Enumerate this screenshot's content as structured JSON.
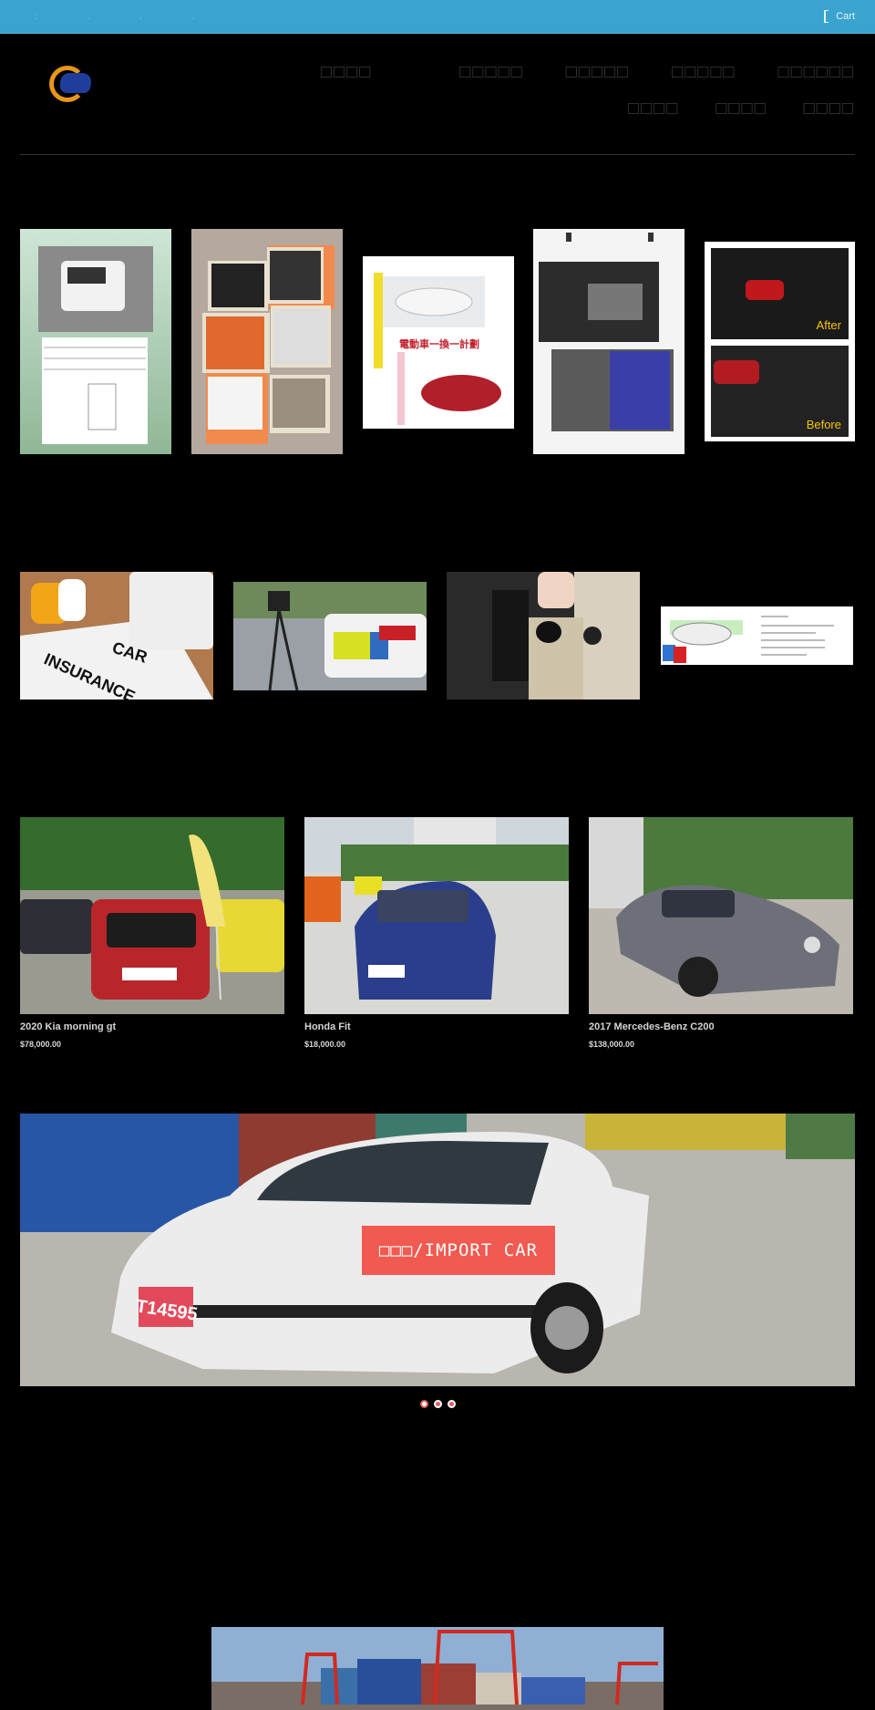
{
  "topbar": {
    "left_glyphs": ":  .   .   .",
    "cart_label": "Cart",
    "bg_color": "#3aa3cf"
  },
  "header": {
    "logo_alt": "logo",
    "nav_row1": [
      "□□□□",
      "□□□□□",
      "□□□□□",
      "□□□□□",
      "□□□□□□"
    ],
    "nav_row2": [
      "□□□□",
      "□□□□",
      "□□□□"
    ]
  },
  "gallery_row1": [
    {
      "name": "auction-sheet-tile",
      "caption": ""
    },
    {
      "name": "used-cars-collage-tile",
      "caption": ""
    },
    {
      "name": "ev-trade-in-tile",
      "caption": "電動車一換一計劃"
    },
    {
      "name": "car-repair-tile",
      "caption": ""
    },
    {
      "name": "bodywork-before-after-tile",
      "caption_after": "After",
      "caption_before": "Before"
    }
  ],
  "gallery_row2": [
    {
      "name": "car-insurance-tile",
      "text_line1": "CAR",
      "text_line2": "INSURANCE"
    },
    {
      "name": "speed-camera-tile",
      "caption": ""
    },
    {
      "name": "engine-maintenance-tile",
      "caption": ""
    },
    {
      "name": "car-wash-tile",
      "caption": ""
    }
  ],
  "products": [
    {
      "name": "2020 Kia morning gt",
      "price": "$78,000.00"
    },
    {
      "name": "Honda Fit",
      "price": "$18,000.00"
    },
    {
      "name": "2017 Mercedes-Benz C200",
      "price": "$138,000.00"
    }
  ],
  "banner": {
    "cta_label": "□□□/IMPORT CAR",
    "plate": "T14595",
    "cta_color": "#f15a50",
    "slides": 3,
    "active_slide": 1
  }
}
